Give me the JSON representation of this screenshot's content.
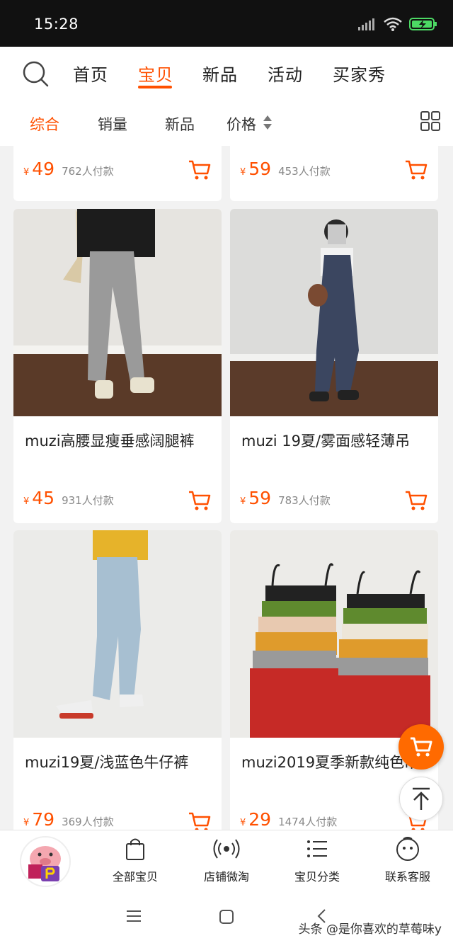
{
  "status": {
    "time": "15:28"
  },
  "nav": {
    "tabs": [
      {
        "label": "首页",
        "active": false
      },
      {
        "label": "宝贝",
        "active": true
      },
      {
        "label": "新品",
        "active": false
      },
      {
        "label": "活动",
        "active": false
      },
      {
        "label": "买家秀",
        "active": false
      }
    ]
  },
  "sort": {
    "items": [
      {
        "label": "综合",
        "active": true
      },
      {
        "label": "销量",
        "active": false
      },
      {
        "label": "新品",
        "active": false
      },
      {
        "label": "价格",
        "active": false
      }
    ]
  },
  "products": [
    {
      "title": "",
      "price": "49",
      "sold": "762人付款",
      "yen": "¥"
    },
    {
      "title": "",
      "price": "59",
      "sold": "453人付款",
      "yen": "¥"
    },
    {
      "title": "muzi高腰显瘦垂感阔腿裤",
      "price": "45",
      "sold": "931人付款",
      "yen": "¥"
    },
    {
      "title": "muzi 19夏/雾面感轻薄吊",
      "price": "59",
      "sold": "783人付款",
      "yen": "¥"
    },
    {
      "title": "muzi19夏/浅蓝色牛仔裤",
      "price": "79",
      "sold": "369人付款",
      "yen": "¥"
    },
    {
      "title": "muzi2019夏季新款纯色吊",
      "price": "29",
      "sold": "1474人付款",
      "yen": "¥"
    }
  ],
  "bottom_nav": {
    "items": [
      {
        "label": "全部宝贝",
        "icon": "shopping-bag-icon"
      },
      {
        "label": "店铺微淘",
        "icon": "broadcast-icon"
      },
      {
        "label": "宝贝分类",
        "icon": "list-icon"
      },
      {
        "label": "联系客服",
        "icon": "chat-face-icon"
      }
    ]
  },
  "watermark": "头条 @是你喜欢的草莓味y",
  "colors": {
    "accent": "#ff5000",
    "cart_fab": "#ff6a00"
  }
}
